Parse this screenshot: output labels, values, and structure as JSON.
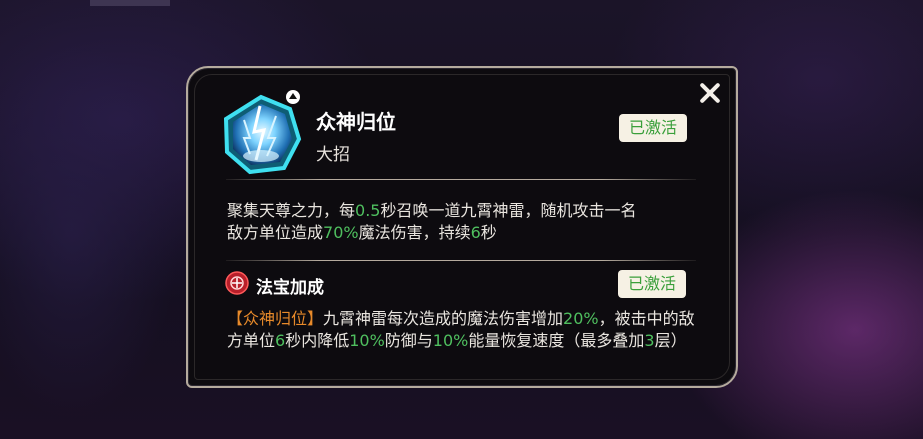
{
  "popup": {
    "skill_name": "众神归位",
    "skill_type": "大招",
    "status_label": "已激活",
    "description": {
      "p1": "聚集天尊之力，每",
      "v1": "0.5",
      "p2": "秒召唤一道九霄神雷，随机攻击一名",
      "p3": "敌方单位造成",
      "v2": "70%",
      "p4": "魔法伤害，持续",
      "v3": "6",
      "p5": "秒"
    },
    "treasure": {
      "title": "法宝加成",
      "status_label": "已激活",
      "tag": "【众神归位】",
      "t1": "九霄神雷每次造成的魔法伤害增加",
      "v1": "20%",
      "t2": "，被击中的敌方单位",
      "v2": "6",
      "t3": "秒内降低",
      "v3": "10%",
      "t4": "防御与",
      "v4": "10%",
      "t5": "能量恢复速度（最多叠加",
      "v5": "3",
      "t6": "层）"
    }
  },
  "icons": {
    "close": "close-icon",
    "skill": "lightning-skill-icon",
    "treasure": "treasure-icon",
    "expand": "caret-up-icon"
  },
  "colors": {
    "highlight": "#4fbf5f",
    "tag": "#e88a2a",
    "badge_text": "#3a9f3a",
    "badge_bg": "#f6f1e4",
    "border": "#b5ab9e"
  }
}
